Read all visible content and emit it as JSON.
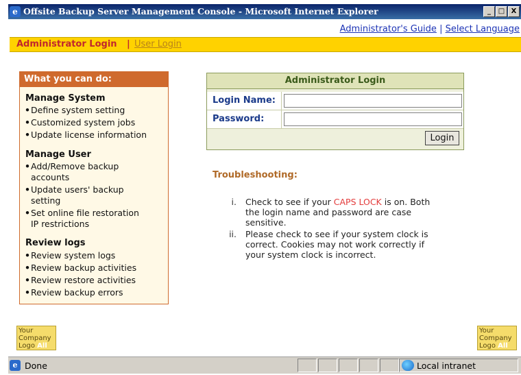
{
  "window": {
    "title": "Offsite Backup Server Management Console - Microsoft Internet Explorer",
    "icon": "ie-icon",
    "buttons": {
      "minimize": "_",
      "maximize": "□",
      "close": "X"
    }
  },
  "top_links": {
    "guide": "Administrator's Guide",
    "separator": "|",
    "language": "Select Language"
  },
  "nav": {
    "admin_login": "Administrator Login",
    "separator": "|",
    "user_login": "User Login"
  },
  "side_panel": {
    "header": "What you can do:",
    "sections": [
      {
        "title": "Manage System",
        "items": [
          "Define system setting",
          "Customized system jobs",
          "Update license information"
        ]
      },
      {
        "title": "Manage User",
        "items": [
          [
            "Add/Remove backup",
            "accounts"
          ],
          [
            "Update users' backup",
            "setting"
          ],
          [
            "Set online file restoration",
            "IP restrictions"
          ]
        ]
      },
      {
        "title": "Review logs",
        "items": [
          "Review system logs",
          "Review backup activities",
          "Review restore activities",
          "Review backup errors"
        ]
      }
    ],
    "bullet": "•"
  },
  "login_box": {
    "title": "Administrator Login",
    "login_name_label": "Login Name:",
    "login_name_value": "",
    "password_label": "Password:",
    "password_value": "",
    "button": "Login"
  },
  "troubleshooting": {
    "title": "Troubleshooting:",
    "items": [
      {
        "num": "i.",
        "line1_pre": "Check to see if your ",
        "line1_caps": "CAPS LOCK",
        "line1_post": " is on. Both",
        "line2": "the login name and password are case",
        "line3": "sensitive."
      },
      {
        "num": "ii.",
        "line1": "Please check to see if your system clock is",
        "line2": "correct. Cookies may not work correctly if",
        "line3": "your system clock is incorrect."
      }
    ]
  },
  "logo": {
    "line1": "Your",
    "line2": "Company",
    "line3": "Logo",
    "line3_suffix": "All"
  },
  "status_bar": {
    "text": "Done",
    "zone": "Local intranet"
  },
  "colors": {
    "nav_bg": "#ffd200",
    "side_header": "#cf6a2d",
    "caps_lock": "#e33b3b",
    "link": "#1c33b5"
  }
}
